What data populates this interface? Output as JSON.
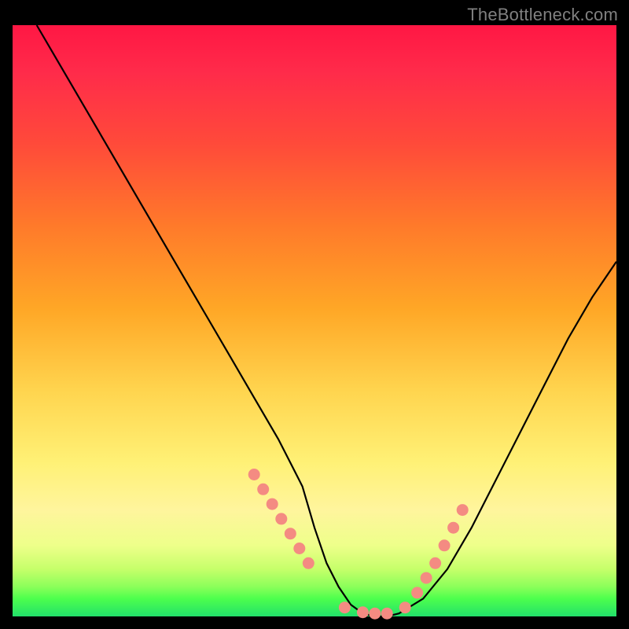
{
  "watermark": "TheBottleneck.com",
  "chart_data": {
    "type": "line",
    "title": "",
    "xlabel": "",
    "ylabel": "",
    "xlim": [
      0,
      100
    ],
    "ylim": [
      0,
      100
    ],
    "series": [
      {
        "name": "bottleneck-curve",
        "x": [
          4,
          8,
          12,
          16,
          20,
          24,
          28,
          32,
          36,
          40,
          44,
          46,
          48,
          50,
          52,
          54,
          56,
          58,
          60,
          62,
          64,
          68,
          72,
          76,
          80,
          84,
          88,
          92,
          96,
          100
        ],
        "values": [
          100,
          93,
          86,
          79,
          72,
          65,
          58,
          51,
          44,
          37,
          30,
          26,
          22,
          15,
          9,
          5,
          2,
          0.5,
          0,
          0,
          0.5,
          3,
          8,
          15,
          23,
          31,
          39,
          47,
          54,
          60
        ]
      }
    ],
    "markers": {
      "name": "highlight-dots",
      "color": "#f48b82",
      "x": [
        40,
        41.5,
        43,
        44.5,
        46,
        47.5,
        49,
        55,
        58,
        60,
        62,
        65,
        67,
        68.5,
        70,
        71.5,
        73,
        74.5
      ],
      "values": [
        24,
        21.5,
        19,
        16.5,
        14,
        11.5,
        9,
        1.5,
        0.7,
        0.5,
        0.5,
        1.5,
        4,
        6.5,
        9,
        12,
        15,
        18
      ]
    },
    "gradient_stops": [
      {
        "pos": 0,
        "color": "#ff1744"
      },
      {
        "pos": 50,
        "color": "#ffc107"
      },
      {
        "pos": 85,
        "color": "#fff176"
      },
      {
        "pos": 100,
        "color": "#22e06a"
      }
    ]
  }
}
